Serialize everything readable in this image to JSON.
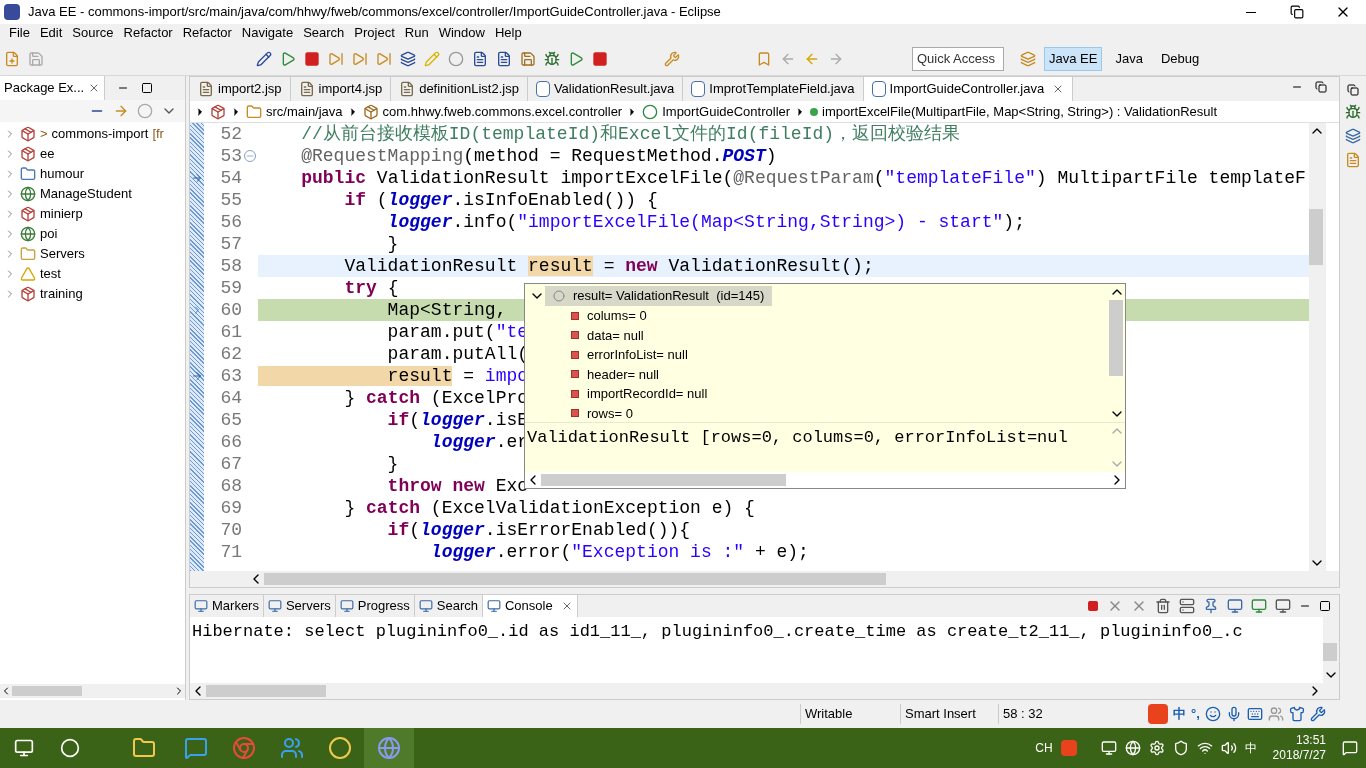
{
  "window": {
    "title": "Java EE - commons-import/src/main/java/com/hhwy/fweb/commons/excel/controller/ImportGuideController.java - Eclipse"
  },
  "menu": [
    "File",
    "Edit",
    "Source",
    "Refactor",
    "Refactor",
    "Navigate",
    "Search",
    "Project",
    "Run",
    "Window",
    "Help"
  ],
  "toolbar": {
    "quick_access": {
      "placeholder": "Quick Access"
    },
    "perspectives": [
      {
        "label": "Java EE",
        "selected": true
      },
      {
        "label": "Java",
        "selected": false
      },
      {
        "label": "Debug",
        "selected": false
      }
    ]
  },
  "package_explorer": {
    "title": "Package Ex...",
    "items": [
      {
        "label": "commons-import",
        "prefix": ">",
        "suffix": "[fr",
        "kind": "maven"
      },
      {
        "label": "ee",
        "kind": "maven"
      },
      {
        "label": "humour",
        "kind": "plain"
      },
      {
        "label": "ManageStudent",
        "kind": "web"
      },
      {
        "label": "minierp",
        "kind": "maven"
      },
      {
        "label": "poi",
        "kind": "web"
      },
      {
        "label": "Servers",
        "kind": "folder"
      },
      {
        "label": "test",
        "kind": "warn"
      },
      {
        "label": "training",
        "kind": "maven"
      }
    ]
  },
  "editor": {
    "tabs": [
      {
        "label": "import2.jsp",
        "kind": "jsp",
        "selected": false
      },
      {
        "label": "import4.jsp",
        "kind": "jsp",
        "selected": false
      },
      {
        "label": "definitionList2.jsp",
        "kind": "jsp",
        "selected": false
      },
      {
        "label": "ValidationResult.java",
        "kind": "java",
        "selected": false
      },
      {
        "label": "ImprotTemplateField.java",
        "kind": "java",
        "selected": false
      },
      {
        "label": "ImportGuideController.java",
        "kind": "java",
        "selected": true
      }
    ],
    "breadcrumb": [
      {
        "label": "src/main/java",
        "kind": "source"
      },
      {
        "label": "com.hhwy.fweb.commons.excel.controller",
        "kind": "package"
      },
      {
        "label": "ImportGuideController",
        "kind": "class"
      },
      {
        "label": "importExcelFile(MultipartFile, Map<String, String>) : ValidationResult",
        "kind": "method"
      }
    ],
    "lines": [
      {
        "no": "52",
        "tokens": [
          {
            "t": "    //从前台接收模板ID(templateId)和Excel文件的Id(fileId)，返回校验结果",
            "kind": "comment"
          }
        ]
      },
      {
        "no": "53",
        "fold": true,
        "tokens": [
          {
            "t": "    @RequestMapping",
            "kind": "annotation"
          },
          {
            "t": "(method = RequestMethod.",
            "kind": "plain"
          },
          {
            "t": "POST",
            "kind": "constant"
          },
          {
            "t": ")",
            "kind": "plain"
          }
        ]
      },
      {
        "no": "54",
        "marker": {
          "kind": "override"
        },
        "tokens": [
          {
            "t": "    public",
            "kind": "keyword"
          },
          {
            "t": " ValidationResult importExcelFile(",
            "kind": "plain"
          },
          {
            "t": "@RequestParam",
            "kind": "annotation"
          },
          {
            "t": "(",
            "kind": "plain"
          },
          {
            "t": "\"templateFile\"",
            "kind": "string"
          },
          {
            "t": ") MultipartFile templateF",
            "kind": "plain"
          }
        ]
      },
      {
        "no": "55",
        "tokens": [
          {
            "t": "        if",
            "kind": "keyword"
          },
          {
            "t": " (",
            "kind": "plain"
          },
          {
            "t": "logger",
            "kind": "field"
          },
          {
            "t": ".isInfoEnabled()) {",
            "kind": "plain"
          }
        ]
      },
      {
        "no": "56",
        "tokens": [
          {
            "t": "            logger",
            "kind": "field"
          },
          {
            "t": ".info(",
            "kind": "plain"
          },
          {
            "t": "\"importExcelFile(Map<String,String>) - start\"",
            "kind": "string"
          },
          {
            "t": ");",
            "kind": "plain"
          }
        ]
      },
      {
        "no": "57",
        "tokens": [
          {
            "t": "            }",
            "kind": "plain"
          }
        ]
      },
      {
        "no": "58",
        "current": true,
        "tokens": [
          {
            "t": "        ValidationResult ",
            "kind": "plain"
          },
          {
            "t": "result",
            "kind": "occurrence"
          },
          {
            "t": " = ",
            "kind": "plain"
          },
          {
            "t": "new",
            "kind": "keyword"
          },
          {
            "t": " ValidationResult();",
            "kind": "plain"
          }
        ]
      },
      {
        "no": "59",
        "tokens": [
          {
            "t": "        try",
            "kind": "keyword"
          },
          {
            "t": " {",
            "kind": "plain"
          }
        ]
      },
      {
        "no": "60",
        "marker": {
          "kind": "debug"
        },
        "debug": true,
        "tokens": [
          {
            "t": "            Map<String,",
            "kind": "plain"
          }
        ]
      },
      {
        "no": "61",
        "tokens": [
          {
            "t": "            param.put(",
            "kind": "plain"
          },
          {
            "t": "\"te",
            "kind": "string"
          }
        ]
      },
      {
        "no": "62",
        "tokens": [
          {
            "t": "            param.putAll(",
            "kind": "plain"
          }
        ]
      },
      {
        "no": "63",
        "marker": {
          "kind": "override"
        },
        "tokens": [
          {
            "t": "            result",
            "kind": "occurrence"
          },
          {
            "t": " = ",
            "kind": "plain"
          },
          {
            "t": "impo",
            "kind": "string"
          }
        ]
      },
      {
        "no": "64",
        "tokens": [
          {
            "t": "        } ",
            "kind": "plain"
          },
          {
            "t": "catch",
            "kind": "keyword"
          },
          {
            "t": " (ExcelPro",
            "kind": "plain"
          }
        ]
      },
      {
        "no": "65",
        "tokens": [
          {
            "t": "            if",
            "kind": "keyword"
          },
          {
            "t": "(",
            "kind": "plain"
          },
          {
            "t": "logger",
            "kind": "field"
          },
          {
            "t": ".isE",
            "kind": "plain"
          }
        ]
      },
      {
        "no": "66",
        "tokens": [
          {
            "t": "                logger",
            "kind": "field"
          },
          {
            "t": ".er",
            "kind": "plain"
          }
        ]
      },
      {
        "no": "67",
        "tokens": [
          {
            "t": "            }",
            "kind": "plain"
          }
        ]
      },
      {
        "no": "68",
        "tokens": [
          {
            "t": "            throw new",
            "kind": "keyword"
          },
          {
            "t": " Exc",
            "kind": "plain"
          }
        ]
      },
      {
        "no": "69",
        "tokens": [
          {
            "t": "        } ",
            "kind": "plain"
          },
          {
            "t": "catch",
            "kind": "keyword"
          },
          {
            "t": " (ExcelValidationException e) {",
            "kind": "plain"
          }
        ]
      },
      {
        "no": "70",
        "tokens": [
          {
            "t": "            if",
            "kind": "keyword"
          },
          {
            "t": "(",
            "kind": "plain"
          },
          {
            "t": "logger",
            "kind": "field"
          },
          {
            "t": ".isErrorEnabled()){",
            "kind": "plain"
          }
        ]
      },
      {
        "no": "71",
        "tokens": [
          {
            "t": "                logger",
            "kind": "field"
          },
          {
            "t": ".error(",
            "kind": "plain"
          },
          {
            "t": "\"Exception is :\"",
            "kind": "string"
          },
          {
            "t": " + e);",
            "kind": "plain"
          }
        ]
      }
    ],
    "inspect_popup": {
      "root": {
        "label": "result= ValidationResult  (id=145)",
        "expanded": true,
        "selected": true,
        "children": [
          "colums= 0",
          "data= null",
          "errorInfoList= null",
          "header= null",
          "importRecordId= null",
          "rows= 0"
        ]
      },
      "detail": "ValidationResult [rows=0, colums=0, errorInfoList=nul"
    }
  },
  "bottom_panel": {
    "tabs": [
      {
        "label": "Markers",
        "selected": false
      },
      {
        "label": "Servers",
        "selected": false
      },
      {
        "label": "Progress",
        "selected": false
      },
      {
        "label": "Search",
        "selected": false
      },
      {
        "label": "Console",
        "selected": true
      }
    ],
    "console_line": "Hibernate: select plugininfo0_.id as id1_11_, plugininfo0_.create_time as create_t2_11_, plugininfo0_.c"
  },
  "status_bar": {
    "mode": "Writable",
    "insert": "Smart Insert",
    "position": "58 : 32",
    "ime": [
      "中",
      "°,"
    ]
  },
  "taskbar": {
    "language": "CH",
    "ime": "中",
    "time": "13:51",
    "date": "2018/7/27"
  }
}
